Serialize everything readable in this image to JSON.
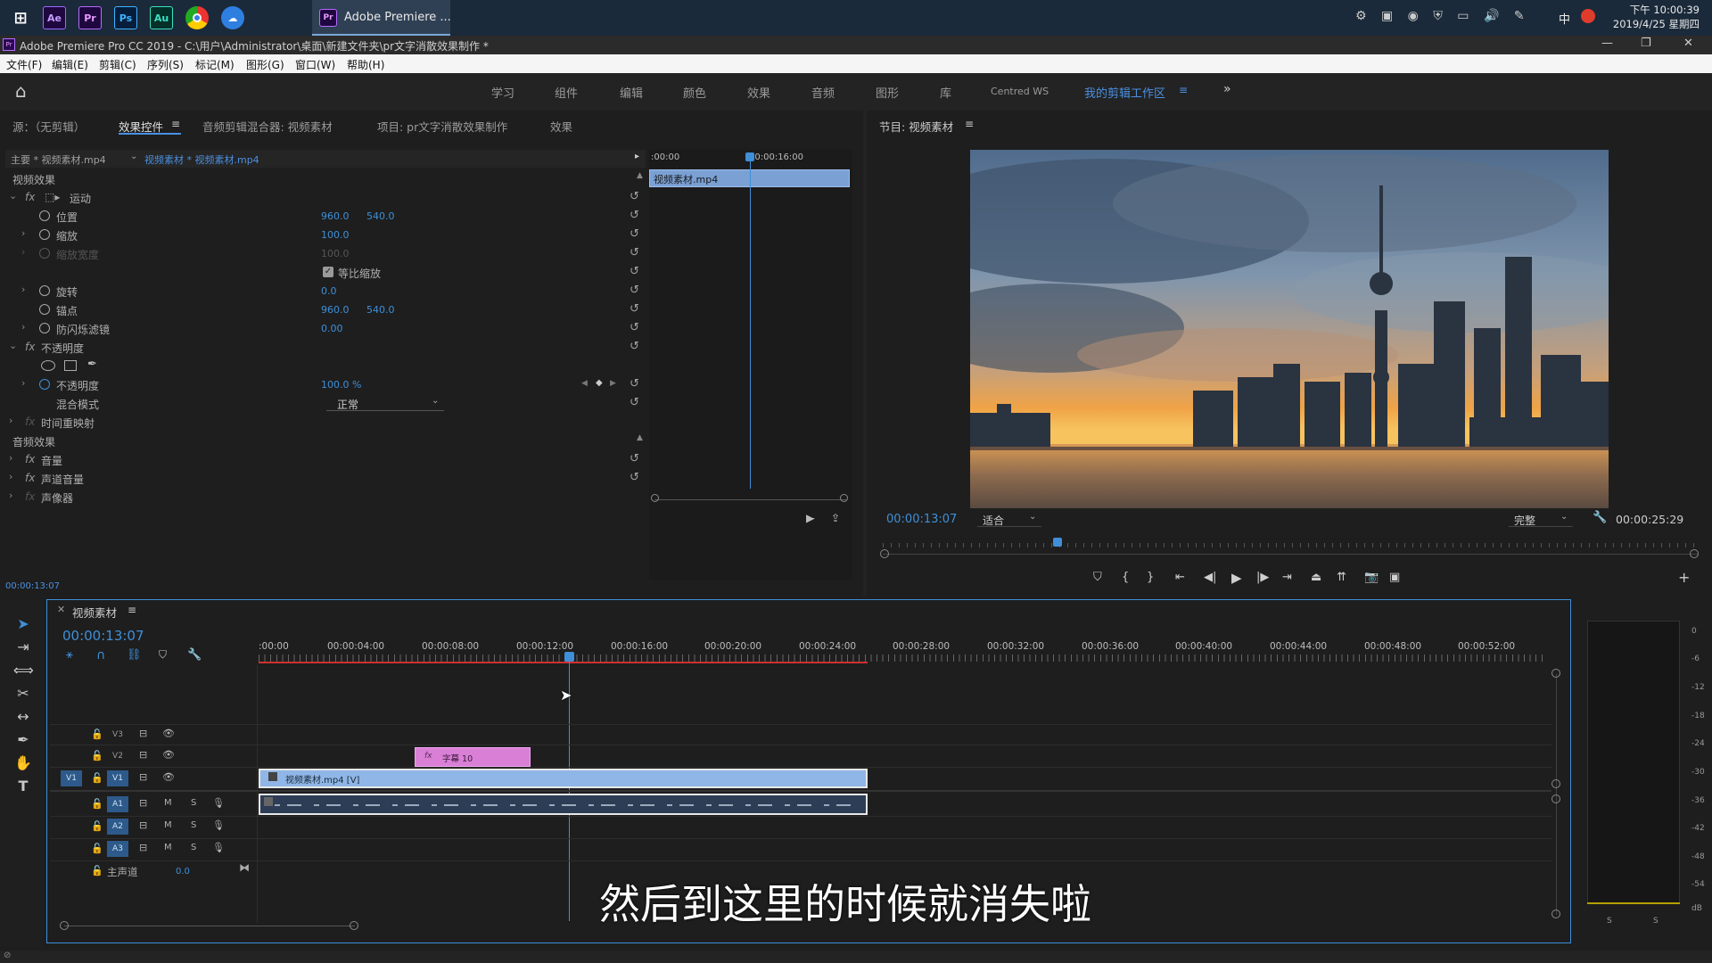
{
  "taskbar": {
    "apps": [
      "Ae",
      "Pr",
      "Ps",
      "Au"
    ],
    "active_window": "Adobe Premiere ...",
    "clock_time": "下午 10:00:39",
    "clock_date": "2019/4/25 星期四",
    "tray_ime": "中"
  },
  "titlebar": {
    "title": "Adobe Premiere Pro CC 2019 - C:\\用户\\Administrator\\桌面\\新建文件夹\\pr文字消散效果制作 *"
  },
  "menu": [
    "文件(F)",
    "编辑(E)",
    "剪辑(C)",
    "序列(S)",
    "标记(M)",
    "图形(G)",
    "窗口(W)",
    "帮助(H)"
  ],
  "workspaces": [
    "学习",
    "组件",
    "编辑",
    "颜色",
    "效果",
    "音频",
    "图形",
    "库",
    "Centred WS",
    "我的剪辑工作区"
  ],
  "source_panel": {
    "tabs": [
      "源：（无剪辑）",
      "效果控件",
      "音频剪辑混合器: 视频素材",
      "项目: pr文字消散效果制作",
      "效果"
    ],
    "master": "主要 * 视频素材.mp4",
    "clip": "视频素材 * 视频素材.mp4",
    "mini_ruler": [
      ":00:00",
      "00:00:16:00"
    ],
    "mini_clip": "视频素材.mp4",
    "video_effects": "视频效果",
    "motion": "运动",
    "position": {
      "label": "位置",
      "x": "960.0",
      "y": "540.0"
    },
    "scale": {
      "label": "缩放",
      "value": "100.0"
    },
    "scale_width": {
      "label": "缩放宽度",
      "value": "100.0"
    },
    "uniform_scale": "等比缩放",
    "rotation": {
      "label": "旋转",
      "value": "0.0"
    },
    "anchor": {
      "label": "锚点",
      "x": "960.0",
      "y": "540.0"
    },
    "antiflicker": {
      "label": "防闪烁滤镜",
      "value": "0.00"
    },
    "opacity_group": "不透明度",
    "opacity": {
      "label": "不透明度",
      "value": "100.0 %"
    },
    "blend": {
      "label": "混合模式",
      "value": "正常"
    },
    "time_remap": "时间重映射",
    "audio_effects": "音频效果",
    "volume": "音量",
    "channel_volume": "声道音量",
    "panner": "声像器",
    "timecode": "00:00:13:07"
  },
  "program_panel": {
    "tab": "节目: 视频素材",
    "timecode": "00:00:13:07",
    "fit": "适合",
    "quality": "完整",
    "duration": "00:00:25:29"
  },
  "timeline": {
    "tab": "视频素材",
    "timecode": "00:00:13:07",
    "ruler": [
      ":00:00",
      "00:00:04:00",
      "00:00:08:00",
      "00:00:12:00",
      "00:00:16:00",
      "00:00:20:00",
      "00:00:24:00",
      "00:00:28:00",
      "00:00:32:00",
      "00:00:36:00",
      "00:00:40:00",
      "00:00:44:00",
      "00:00:48:00",
      "00:00:52:00"
    ],
    "tracks": [
      "V3",
      "V2",
      "V1",
      "A1",
      "A2",
      "A3"
    ],
    "source_v1": "V1",
    "master_label": "主声道",
    "master_value": "0.0",
    "title_clip": "字幕 10",
    "video_clip": "视频素材.mp4 [V]",
    "mute": "M",
    "solo": "S"
  },
  "subtitle": "然后到这里的时候就消失啦",
  "meter": {
    "scale": [
      "0",
      "-6",
      "-12",
      "-18",
      "-24",
      "-30",
      "-36",
      "-42",
      "-48",
      "-54",
      "dB"
    ],
    "solo": [
      "S",
      "S"
    ]
  },
  "colors": {
    "accent": "#3f8fd8",
    "title_clip": "#d97fd6",
    "video_clip": "#8fb6e6",
    "playhead": "#3f8fd8",
    "panel": "#1e1e1e"
  }
}
